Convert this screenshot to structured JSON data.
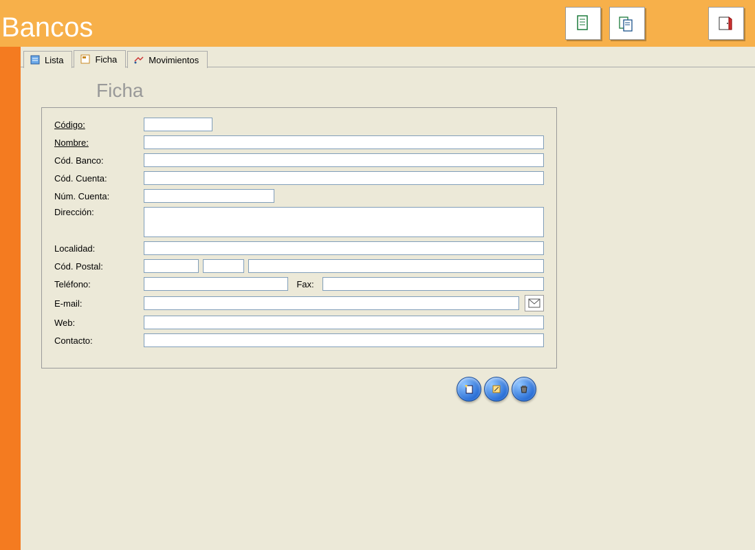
{
  "title": "Bancos",
  "toolbar": {
    "new_doc": "document-icon",
    "copy_doc": "documents-icon",
    "exit": "exit-icon"
  },
  "tabs": [
    {
      "label": "Lista",
      "icon": "list-icon",
      "active": false
    },
    {
      "label": "Ficha",
      "icon": "form-icon",
      "active": true
    },
    {
      "label": "Movimientos",
      "icon": "moves-icon",
      "active": false
    }
  ],
  "section_title": "Ficha",
  "fields": {
    "codigo_label": "Código:",
    "codigo_value": "",
    "nombre_label": "Nombre:",
    "nombre_value": "",
    "codbanco_label": "Cód. Banco:",
    "codbanco_value": "",
    "codcuenta_label": "Cód. Cuenta:",
    "codcuenta_value": "",
    "numcuenta_label": "Núm. Cuenta:",
    "numcuenta_value": "",
    "direccion_label": "Dirección:",
    "direccion_value": "",
    "localidad_label": "Localidad:",
    "localidad_value": "",
    "codpostal_label": "Cód. Postal:",
    "codpostal_value1": "",
    "codpostal_value2": "",
    "codpostal_value3": "",
    "telefono_label": "Teléfono:",
    "telefono_value": "",
    "fax_label": "Fax:",
    "fax_value": "",
    "email_label": "E-mail:",
    "email_value": "",
    "web_label": "Web:",
    "web_value": "",
    "contacto_label": "Contacto:",
    "contacto_value": ""
  },
  "actions": {
    "new": "new-record",
    "edit": "edit-record",
    "delete": "delete-record"
  }
}
